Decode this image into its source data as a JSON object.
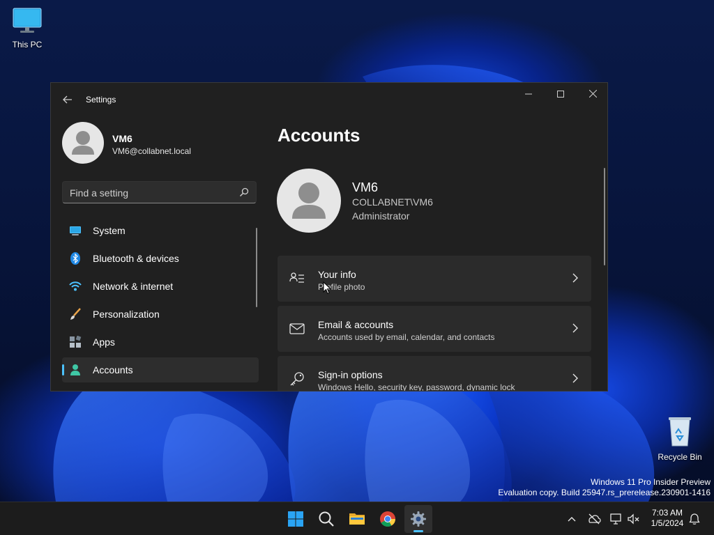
{
  "desktop": {
    "icons": [
      {
        "label": "This PC",
        "icon": "monitor-icon"
      },
      {
        "label": "Recycle Bin",
        "icon": "recycle-bin-icon"
      }
    ],
    "watermark": {
      "line1": "Windows 11 Pro Insider Preview",
      "line2": "Evaluation copy. Build 25947.rs_prerelease.230901-1416"
    }
  },
  "window": {
    "title": "Settings",
    "controls": {
      "minimize": "minimize-icon",
      "maximize": "maximize-icon",
      "close": "close-icon"
    }
  },
  "profile": {
    "name": "VM6",
    "email": "VM6@collabnet.local"
  },
  "search": {
    "placeholder": "Find a setting",
    "value": ""
  },
  "nav": {
    "items": [
      {
        "label": "System",
        "icon": "system-icon",
        "active": false
      },
      {
        "label": "Bluetooth & devices",
        "icon": "bluetooth-icon",
        "active": false
      },
      {
        "label": "Network & internet",
        "icon": "wifi-icon",
        "active": false
      },
      {
        "label": "Personalization",
        "icon": "brush-icon",
        "active": false
      },
      {
        "label": "Apps",
        "icon": "apps-icon",
        "active": false
      },
      {
        "label": "Accounts",
        "icon": "accounts-icon",
        "active": true
      }
    ]
  },
  "main": {
    "title": "Accounts",
    "account": {
      "name": "VM6",
      "domain": "COLLABNET\\VM6",
      "role": "Administrator"
    },
    "cards": [
      {
        "title": "Your info",
        "subtitle": "Profile photo",
        "icon": "person-info-icon"
      },
      {
        "title": "Email & accounts",
        "subtitle": "Accounts used by email, calendar, and contacts",
        "icon": "mail-icon"
      },
      {
        "title": "Sign-in options",
        "subtitle": "Windows Hello, security key, password, dynamic lock",
        "icon": "key-icon"
      }
    ]
  },
  "taskbar": {
    "apps": [
      {
        "name": "Start",
        "icon": "windows-start-icon"
      },
      {
        "name": "Search",
        "icon": "search-icon"
      },
      {
        "name": "File Explorer",
        "icon": "folder-icon"
      },
      {
        "name": "Google Chrome",
        "icon": "chrome-icon"
      },
      {
        "name": "Settings",
        "icon": "gear-icon",
        "active": true
      }
    ],
    "tray": [
      "chevron-up-icon",
      "onedrive-offline-icon",
      "network-icon",
      "volume-muted-icon",
      "notification-bell-icon"
    ],
    "time": "7:03 AM",
    "date": "1/5/2024"
  },
  "colors": {
    "accent": "#4cc2ff",
    "window_bg": "#202020",
    "card_bg": "#2b2b2b"
  }
}
